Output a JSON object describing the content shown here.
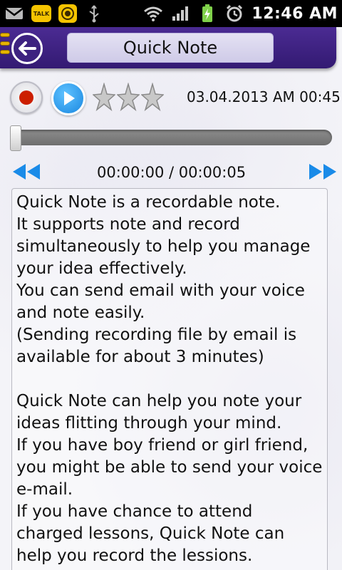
{
  "statusbar": {
    "left_icons": [
      "gmail-icon",
      "kakaotalk-icon",
      "camera-app-icon",
      "usb-icon"
    ],
    "talk_label": "TALK",
    "right_icons": [
      "wifi-icon",
      "signal-icon",
      "battery-charging-icon",
      "alarm-icon"
    ],
    "time": "12:46 AM"
  },
  "header": {
    "title": "Quick Note",
    "back_icon": "back-arrow-icon",
    "colors": {
      "bar": "#3d2280",
      "accent": "#e6b400"
    }
  },
  "controls": {
    "record_icon": "record-icon",
    "play_icon": "play-icon",
    "rating": {
      "max": 3,
      "value": 0
    },
    "datetime": "03.04.2013 AM 00:45"
  },
  "player": {
    "position_fraction": 0,
    "time_readout": "00:00:00 / 00:00:05",
    "rewind_icon": "rewind-icon",
    "forward_icon": "fast-forward-icon"
  },
  "note": {
    "text": "Quick Note is a recordable note.\nIt supports note and record simultaneously to help you manage your idea effectively.\nYou can send email with your voice and note easily.\n(Sending recording file by email is available for about 3 minutes)\n\nQuick Note can help you note your ideas flitting through your mind.\nIf you have boy friend or girl friend, you might be able to send your voice e-mail.\nIf you have chance to attend charged lessons, Quick Note can help you record the lessions."
  }
}
